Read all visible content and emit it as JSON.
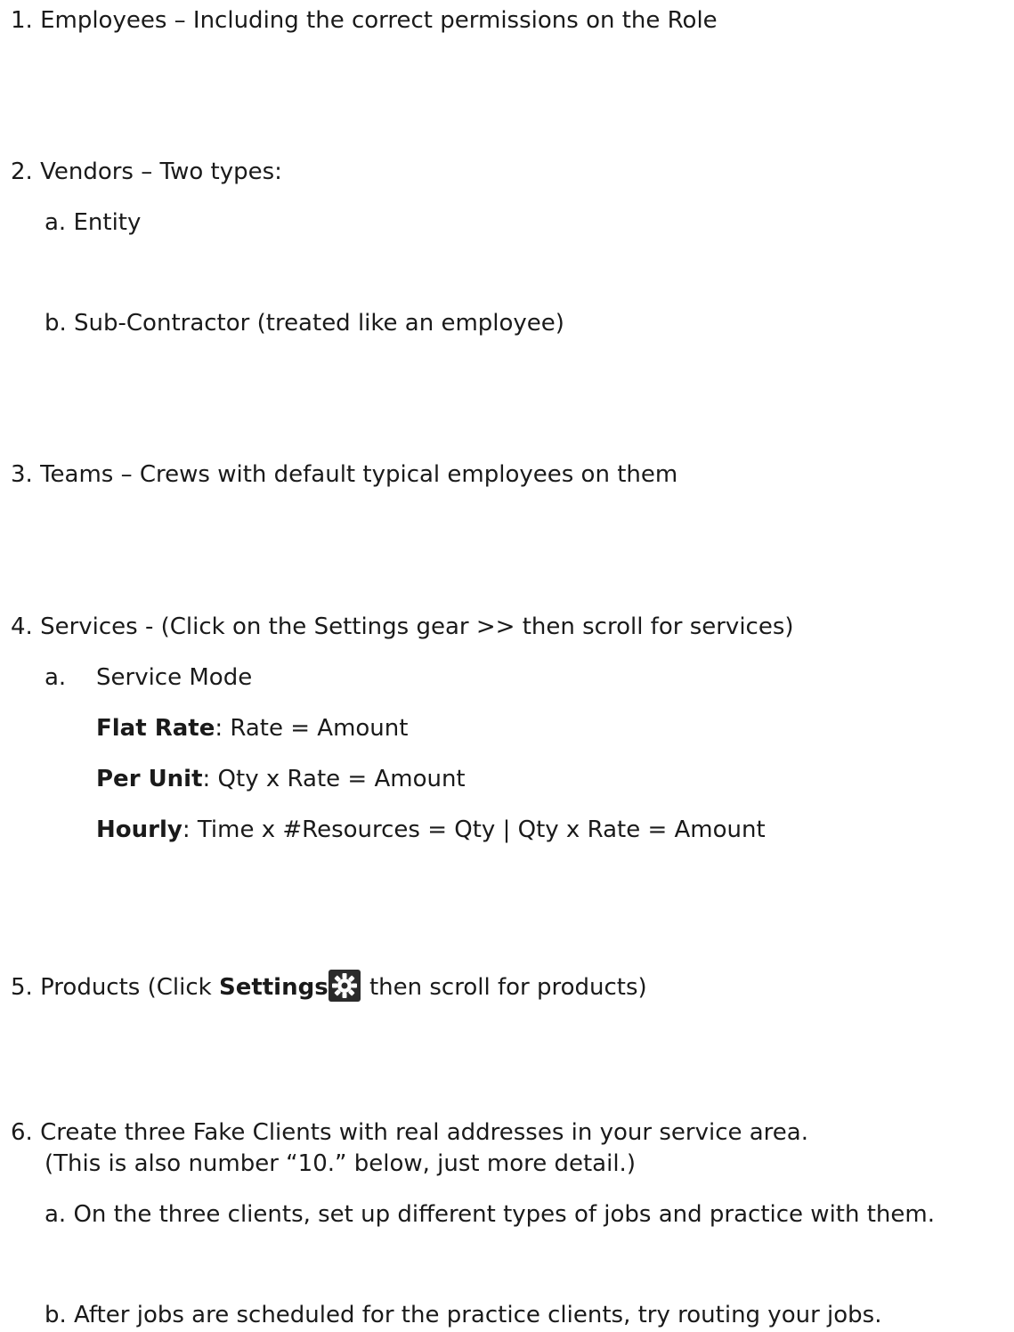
{
  "items": {
    "i1": "1. Employees – Including the correct permissions on the Role",
    "i2": "2. Vendors – Two types:",
    "i2a": "a. Entity",
    "i2b": "b. Sub-Contractor (treated like an employee)",
    "i3": "3. Teams – Crews with default typical employees on them",
    "i4": "4. Services - (Click on the Settings gear >> then scroll for services)",
    "i4a_marker": "a.",
    "i4a_text": "Service Mode",
    "flat_rate_label": "Flat Rate",
    "flat_rate_text": ": Rate = Amount",
    "per_unit_label": "Per Unit",
    "per_unit_text": ": Qty x Rate = Amount",
    "hourly_label": "Hourly",
    "hourly_text": ": Time x #Resources = Qty | Qty x Rate = Amount",
    "i5_prefix": "5. Products (Click ",
    "i5_bold": "Settings",
    "i5_suffix": " then scroll for products)",
    "i6_line1": "6. Create three Fake Clients with real addresses in your service area.",
    "i6_line2": "(This is also number “10.” below, just more detail.)",
    "i6a": "a. On the three clients, set up different types of jobs and practice with them.",
    "i6b": "b. After jobs are scheduled for the practice clients, try routing your jobs."
  },
  "icons": {
    "settings_gear": "gear-icon"
  },
  "colors": {
    "text": "#1a1a1a",
    "gear_bg": "#2b2b2b",
    "gear_fg": "#ffffff"
  }
}
